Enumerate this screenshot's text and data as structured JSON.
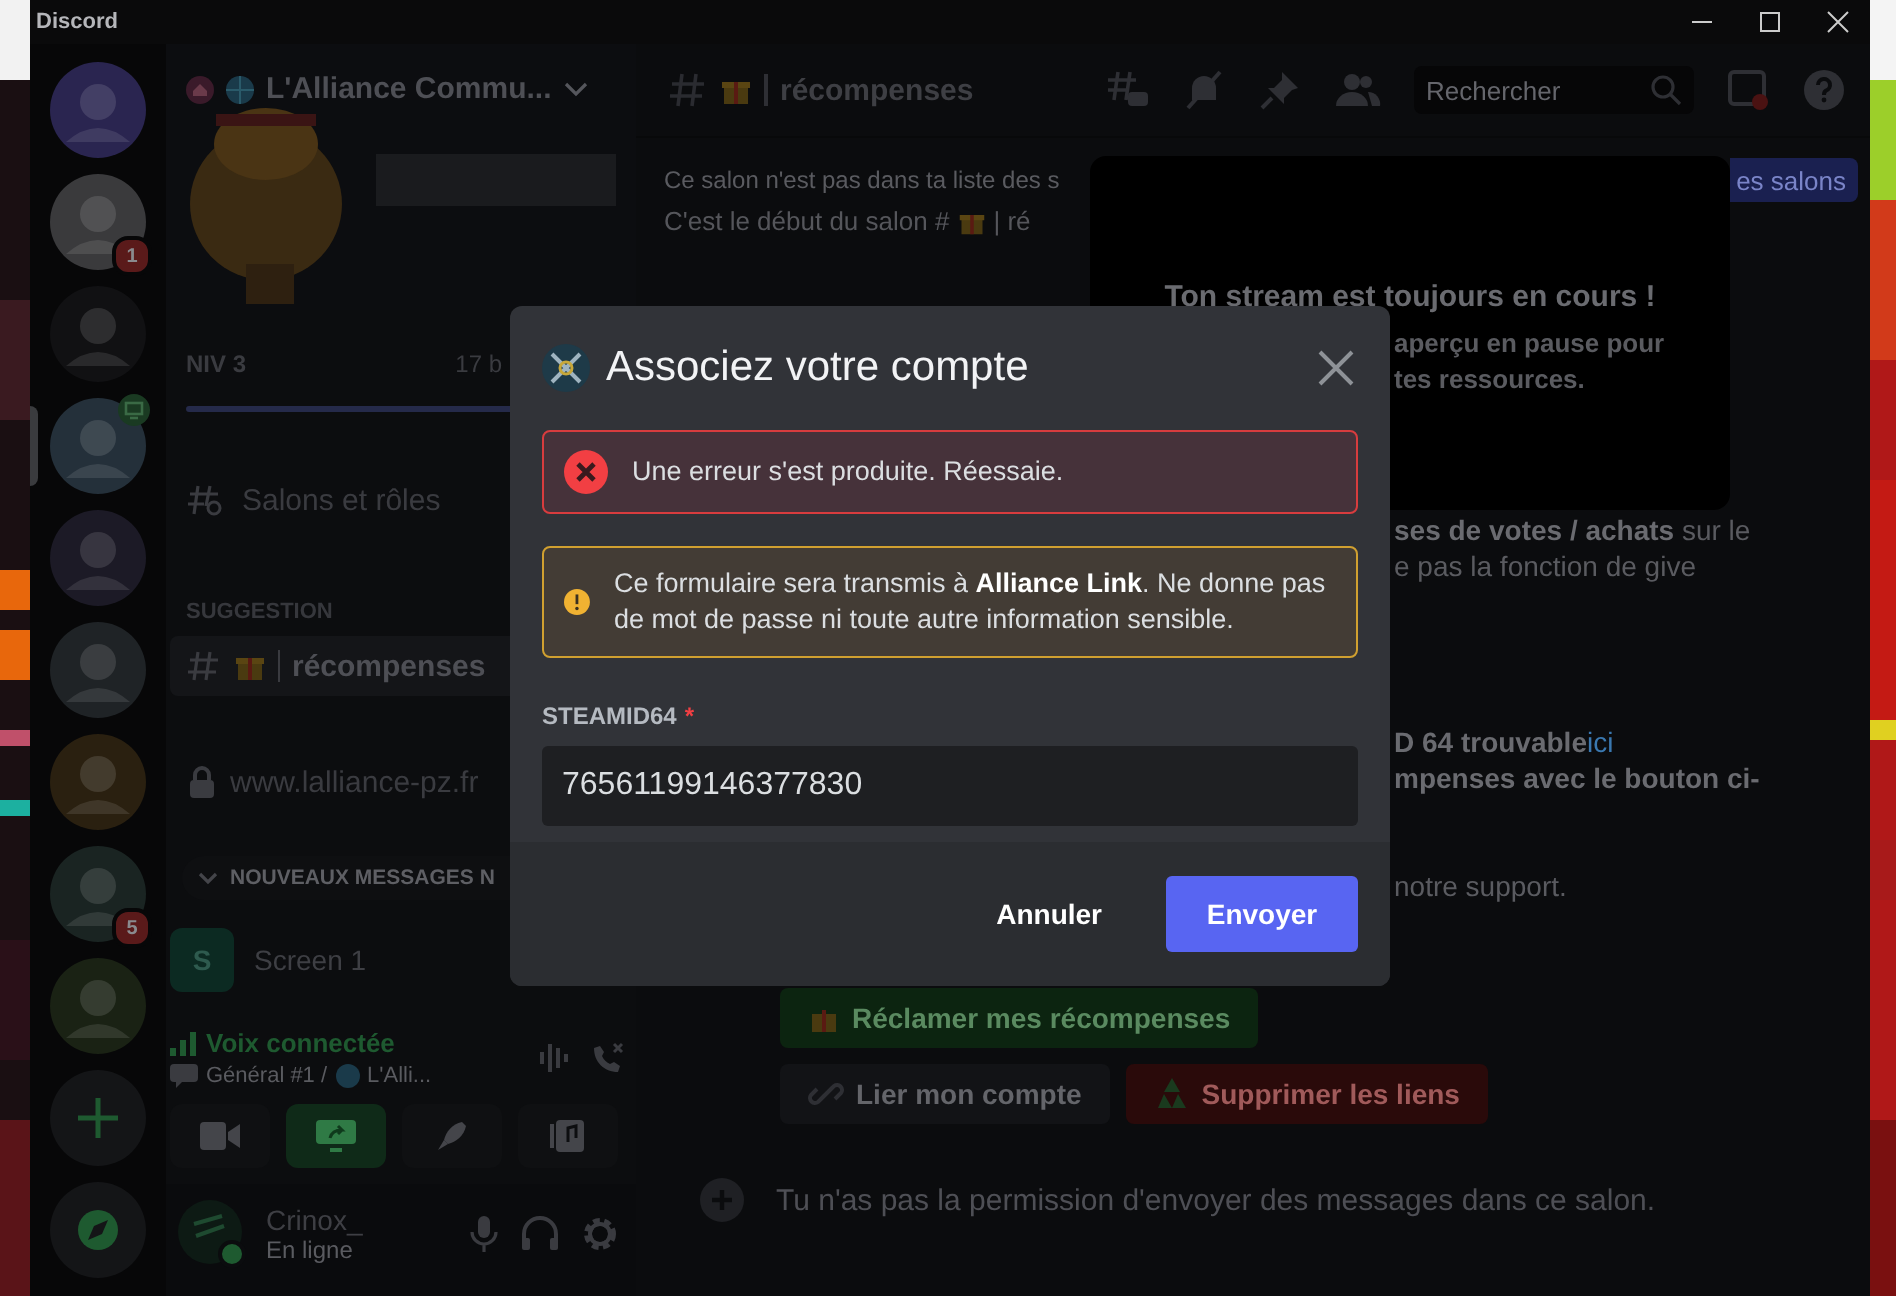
{
  "window": {
    "title": "Discord"
  },
  "servers": [
    {
      "selected": false,
      "streaming": false
    },
    {
      "selected": false,
      "streaming": false,
      "badge": "1"
    },
    {
      "selected": false,
      "streaming": false
    },
    {
      "selected": true,
      "streaming": true
    },
    {
      "selected": false,
      "streaming": false
    },
    {
      "selected": false,
      "streaming": false
    },
    {
      "selected": false,
      "streaming": false
    },
    {
      "selected": false,
      "streaming": false,
      "badge": "5"
    },
    {
      "selected": false,
      "streaming": false
    }
  ],
  "sidebar": {
    "server_name": "L'Alliance Commu...",
    "boost_level": "NIV 3",
    "boost_count": "17 b",
    "browse": "Salons et rôles",
    "category": "SUGGESTION",
    "channels": [
      {
        "kind": "text",
        "name": "récompenses",
        "selected": true
      },
      {
        "kind": "locked",
        "name": "www.lalliance-pz.fr",
        "selected": false
      }
    ],
    "new_messages": "NOUVEAUX MESSAGES N",
    "voice_users": [
      {
        "initial": "S",
        "name": "Screen 1"
      }
    ],
    "voice": {
      "status": "Voix connectée",
      "channel": "Général #1 /",
      "server": "L'Alli...",
      "buttons": [
        {
          "kind": "camera",
          "active": false
        },
        {
          "kind": "screen",
          "active": true
        },
        {
          "kind": "activity",
          "active": false
        },
        {
          "kind": "soundboard",
          "active": false
        }
      ]
    },
    "user": {
      "name": "Crinox_",
      "status": "En ligne"
    }
  },
  "chat": {
    "channel": "récompenses",
    "search_placeholder": "Rechercher",
    "notice": {
      "text": "Ce salon n'est pas dans ta liste des s",
      "button": "es salons"
    },
    "intro": {
      "before": "C'est le début du salon #",
      "after": "| ré"
    },
    "stream_popup": {
      "title": "Ton stream est toujours en cours !",
      "lines": [
        "aperçu en pause pour",
        "tes ressources."
      ]
    },
    "paragraphs": [
      [
        {
          "text": "**ses de votes / achats** sur le"
        },
        {
          "text": "e pas la fonction de give"
        }
      ],
      [
        {
          "text": "**D 64 trouvable**",
          "link": "ici"
        },
        {
          "text": "**mpenses avec le bouton ci-**"
        }
      ],
      [
        {
          "text": "notre support."
        }
      ]
    ],
    "actions": [
      {
        "label": "Réclamer mes récompenses",
        "kind": "success"
      },
      {
        "label": "Lier mon compte",
        "kind": "secondary"
      },
      {
        "label": "Supprimer les liens",
        "kind": "danger"
      }
    ],
    "composer": {
      "placeholder": "Tu n'as pas la permission d'envoyer des messages dans ce salon."
    }
  },
  "modal": {
    "title": "Associez votre compte",
    "alerts": [
      {
        "kind": "error",
        "text": "Une erreur s'est produite. Réessaie."
      },
      {
        "kind": "warning",
        "text": "Ce formulaire sera transmis à **Alliance Link**. Ne donne pas de mot de passe ni toute autre information sensible."
      }
    ],
    "field": {
      "label": "STEAMID64",
      "required_mark": "*",
      "value": "76561199146377830"
    },
    "buttons": [
      {
        "label": "Annuler",
        "kind": "link"
      },
      {
        "label": "Envoyer",
        "kind": "primary"
      }
    ]
  }
}
